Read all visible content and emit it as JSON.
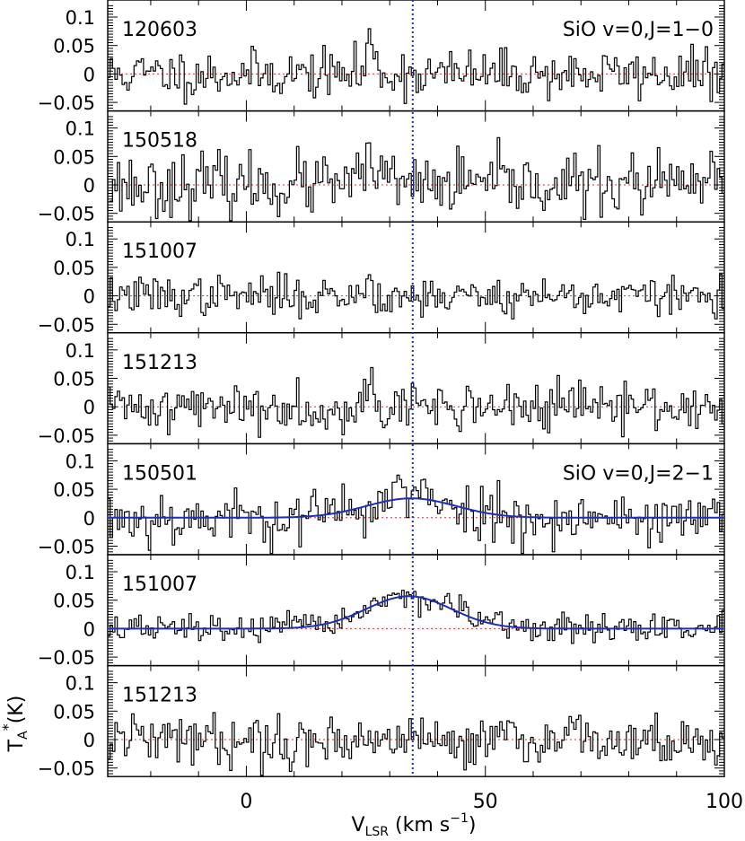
{
  "figure": {
    "ylabel_main": "T",
    "ylabel_sub": "A",
    "ylabel_sup": "*",
    "ylabel_unit": "(K)",
    "xlabel_main": "V",
    "xlabel_sub": "LSR",
    "xlabel_unit_pre": " (km s",
    "xlabel_unit_sup": "−1",
    "xlabel_unit_post": ")",
    "x_tick_labels": [
      "0",
      "50",
      "100"
    ],
    "y_tick_labels": [
      "0.1",
      "0.05",
      "0",
      "−0.05"
    ]
  },
  "chart_data": {
    "type": "line",
    "xlim": [
      -29,
      100
    ],
    "ylim": [
      -0.065,
      0.13
    ],
    "x_major_ticks": [
      0,
      50,
      100
    ],
    "y_ticks": [
      0.1,
      0.05,
      0,
      -0.05
    ],
    "reference_velocity": 34.8,
    "channel_width": 0.5,
    "colors": {
      "spectrum": "#000000",
      "fit": "#1f2fb8",
      "zero_line": "#e03030",
      "reference_line": "#1f2fb8"
    },
    "panels": [
      {
        "label": "120603",
        "line_label": "SiO v=0,J=1−0",
        "noise_rms": 0.021,
        "seed": 11,
        "features": [
          {
            "x": 25.6,
            "sigma": 0.45,
            "amp": 0.07
          },
          {
            "x": 27.2,
            "sigma": 0.5,
            "amp": 0.025
          }
        ],
        "fit": null
      },
      {
        "label": "150518",
        "line_label": "",
        "noise_rms": 0.027,
        "seed": 23,
        "features": [
          {
            "x": 25.8,
            "sigma": 0.4,
            "amp": 0.1
          },
          {
            "x": 27.5,
            "sigma": 0.6,
            "amp": 0.03
          }
        ],
        "fit": null
      },
      {
        "label": "151007",
        "line_label": "",
        "noise_rms": 0.017,
        "seed": 37,
        "features": [
          {
            "x": 25.6,
            "sigma": 0.5,
            "amp": 0.04
          }
        ],
        "fit": null
      },
      {
        "label": "151213",
        "line_label": "",
        "noise_rms": 0.021,
        "seed": 41,
        "features": [
          {
            "x": 25.8,
            "sigma": 0.5,
            "amp": 0.065
          }
        ],
        "fit": null
      },
      {
        "label": "150501",
        "line_label": "SiO v=0,J=2−1",
        "noise_rms": 0.024,
        "seed": 53,
        "features": [
          {
            "x": 32.0,
            "sigma": 0.4,
            "amp": 0.05
          }
        ],
        "fit": {
          "center": 34.5,
          "fwhm": 22.0,
          "amp": 0.034
        }
      },
      {
        "label": "151007",
        "line_label": "",
        "noise_rms": 0.012,
        "seed": 67,
        "features": [],
        "fit": {
          "center": 34.0,
          "fwhm": 21.0,
          "amp": 0.057
        }
      },
      {
        "label": "151213",
        "line_label": "",
        "noise_rms": 0.022,
        "seed": 79,
        "features": [],
        "fit": null
      }
    ]
  }
}
